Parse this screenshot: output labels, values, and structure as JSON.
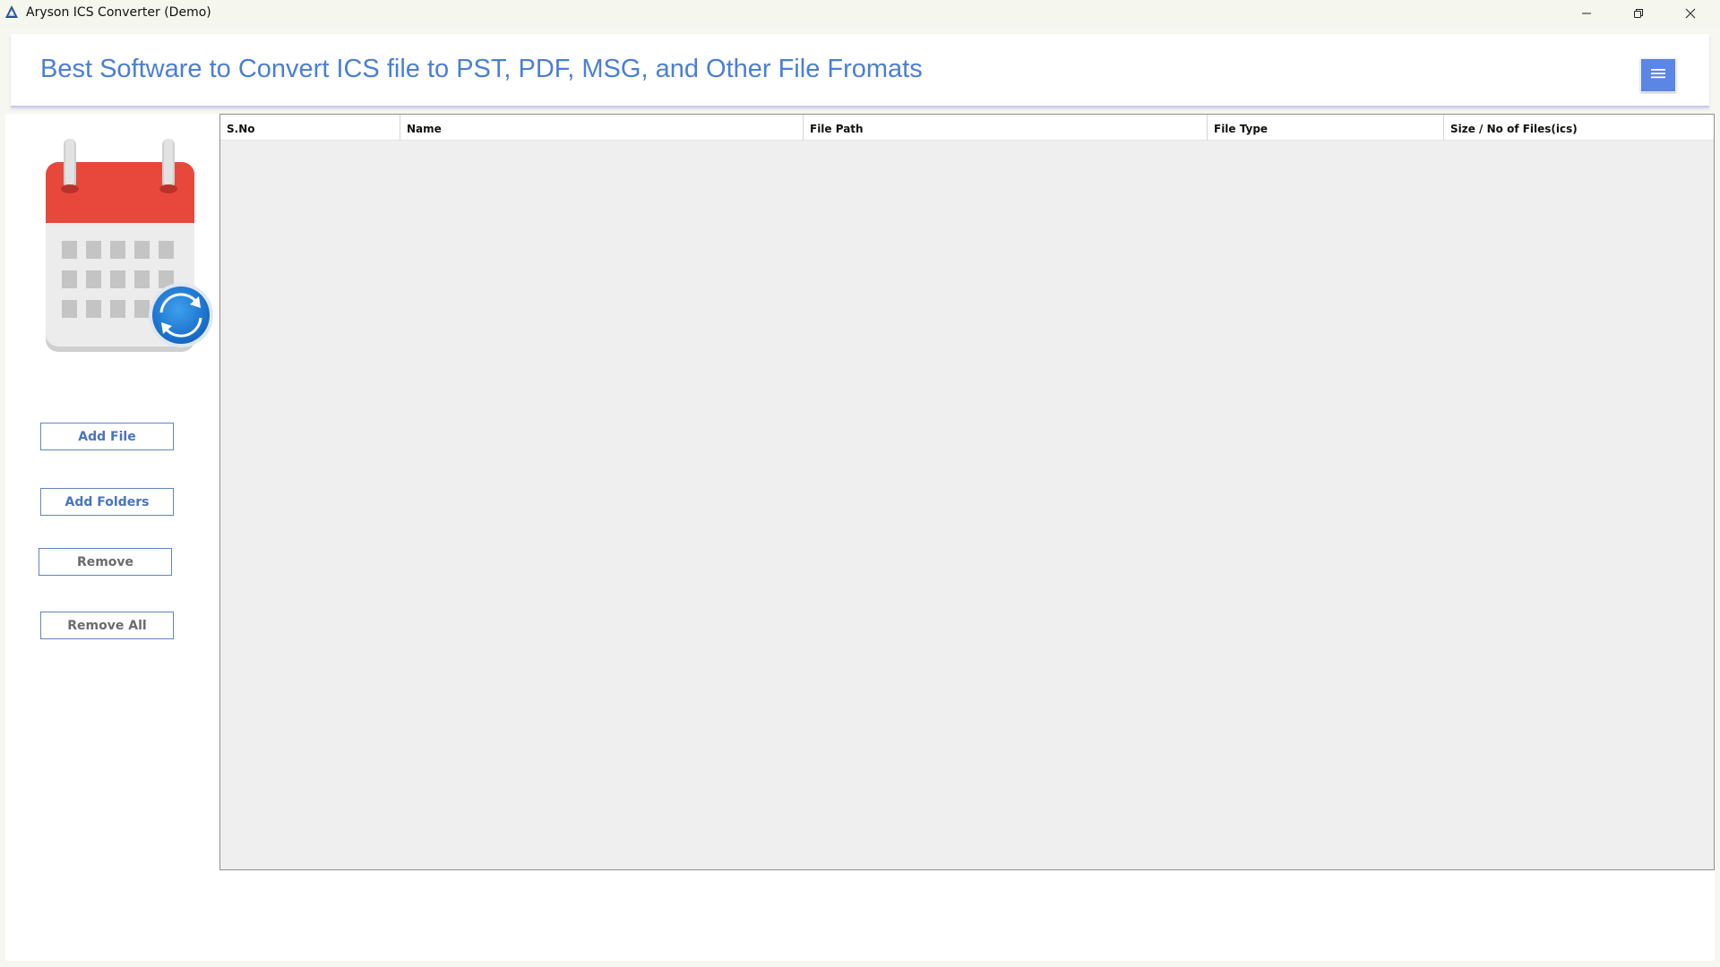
{
  "window": {
    "title": "Aryson ICS Converter (Demo)",
    "controls": {
      "minimize": "minimize-icon",
      "restore": "restore-icon",
      "close": "close-icon"
    }
  },
  "header": {
    "title": "Best Software to Convert ICS file to PST, PDF, MSG, and Other File Fromats",
    "menu_icon": "hamburger-menu-icon"
  },
  "sidebar": {
    "logo_icon": "calendar-sync-icon",
    "buttons": {
      "add_file": "Add File",
      "add_folders": "Add Folders",
      "remove": "Remove",
      "remove_all": "Remove All"
    }
  },
  "table": {
    "columns": [
      "S.No",
      "Name",
      "File Path",
      "File Type",
      "Size / No of Files(ics)"
    ],
    "rows": []
  },
  "colors": {
    "accent": "#4a7fd6",
    "menu_button": "#5b86e5",
    "calendar_red": "#e8483c",
    "sync_blue": "#1f84d8"
  }
}
